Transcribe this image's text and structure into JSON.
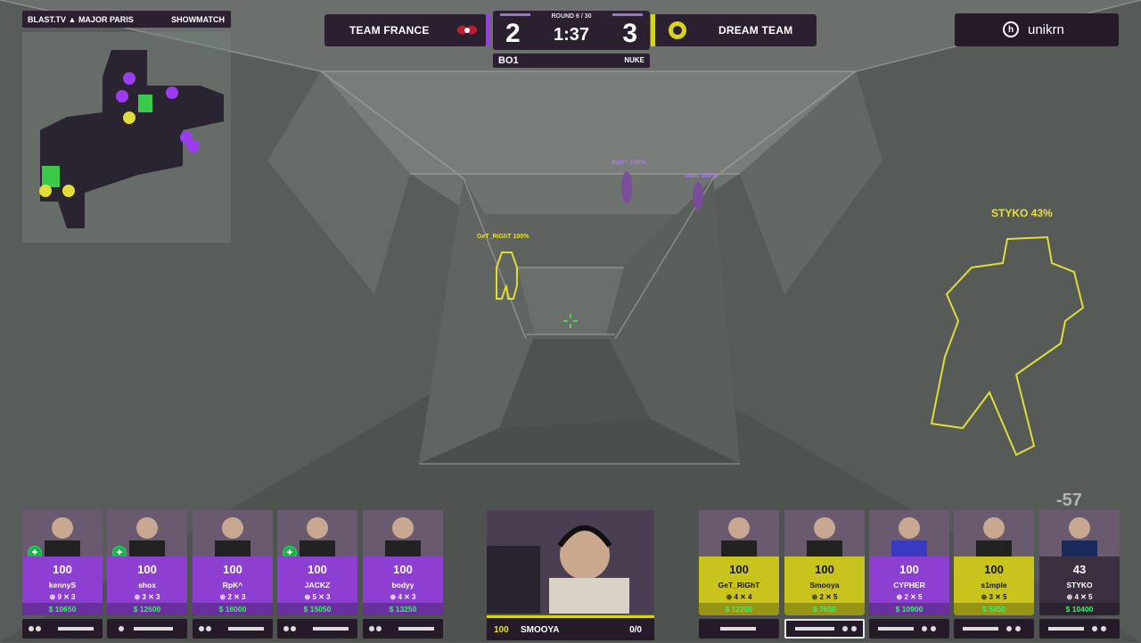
{
  "event": {
    "title": "BLAST.TV",
    "major": "MAJOR PARIS",
    "mode": "SHOWMATCH"
  },
  "scoreboard": {
    "team_left": {
      "name": "TEAM FRANCE",
      "score": "2",
      "color": "#9b3cf0"
    },
    "team_right": {
      "name": "DREAM TEAM",
      "score": "3",
      "color": "#d8d41c"
    },
    "round": "ROUND 6 / 30",
    "timer": "1:37",
    "format": "BO1",
    "map": "NUKE"
  },
  "sponsor": {
    "name": "unikrn",
    "icon": "unikrn-logo-icon"
  },
  "world_labels": {
    "getright": "GeT_RiGhT 100%",
    "rpk": "RpK^ 100%",
    "shox": "shox 100%",
    "styko": "STYKO 43%",
    "damage": "-57"
  },
  "team_left_players": [
    {
      "name": "kennyS",
      "hp": "100",
      "kills": "9",
      "deaths": "3",
      "money": "$ 10650",
      "defuse": true
    },
    {
      "name": "shox",
      "hp": "100",
      "kills": "3",
      "deaths": "3",
      "money": "$ 12600",
      "defuse": true
    },
    {
      "name": "RpK^",
      "hp": "100",
      "kills": "2",
      "deaths": "3",
      "money": "$ 16000",
      "defuse": false
    },
    {
      "name": "JACKZ",
      "hp": "100",
      "kills": "5",
      "deaths": "3",
      "money": "$ 15050",
      "defuse": true
    },
    {
      "name": "bodyy",
      "hp": "100",
      "kills": "4",
      "deaths": "3",
      "money": "$ 13250",
      "defuse": false
    }
  ],
  "team_right_players": [
    {
      "name": "GeT_RiGhT",
      "hp": "100",
      "kills": "4",
      "deaths": "4",
      "money": "$ 12200"
    },
    {
      "name": "Smooya",
      "hp": "100",
      "kills": "2",
      "deaths": "5",
      "money": "$ 7650",
      "selected": true
    },
    {
      "name": "CYPHER",
      "hp": "100",
      "kills": "2",
      "deaths": "5",
      "money": "$ 10900"
    },
    {
      "name": "s1mple",
      "hp": "100",
      "kills": "3",
      "deaths": "5",
      "money": "$ 5850"
    },
    {
      "name": "STYKO",
      "hp": "43",
      "kills": "4",
      "deaths": "5",
      "money": "$ 10400"
    }
  ],
  "observer": {
    "hp": "100",
    "name": "SMOOYA",
    "kd": "0/0"
  },
  "colors": {
    "purple": "#8c3fd0",
    "yellow": "#c9c41d",
    "dark": "#2a2030",
    "money": "#3df06c"
  }
}
